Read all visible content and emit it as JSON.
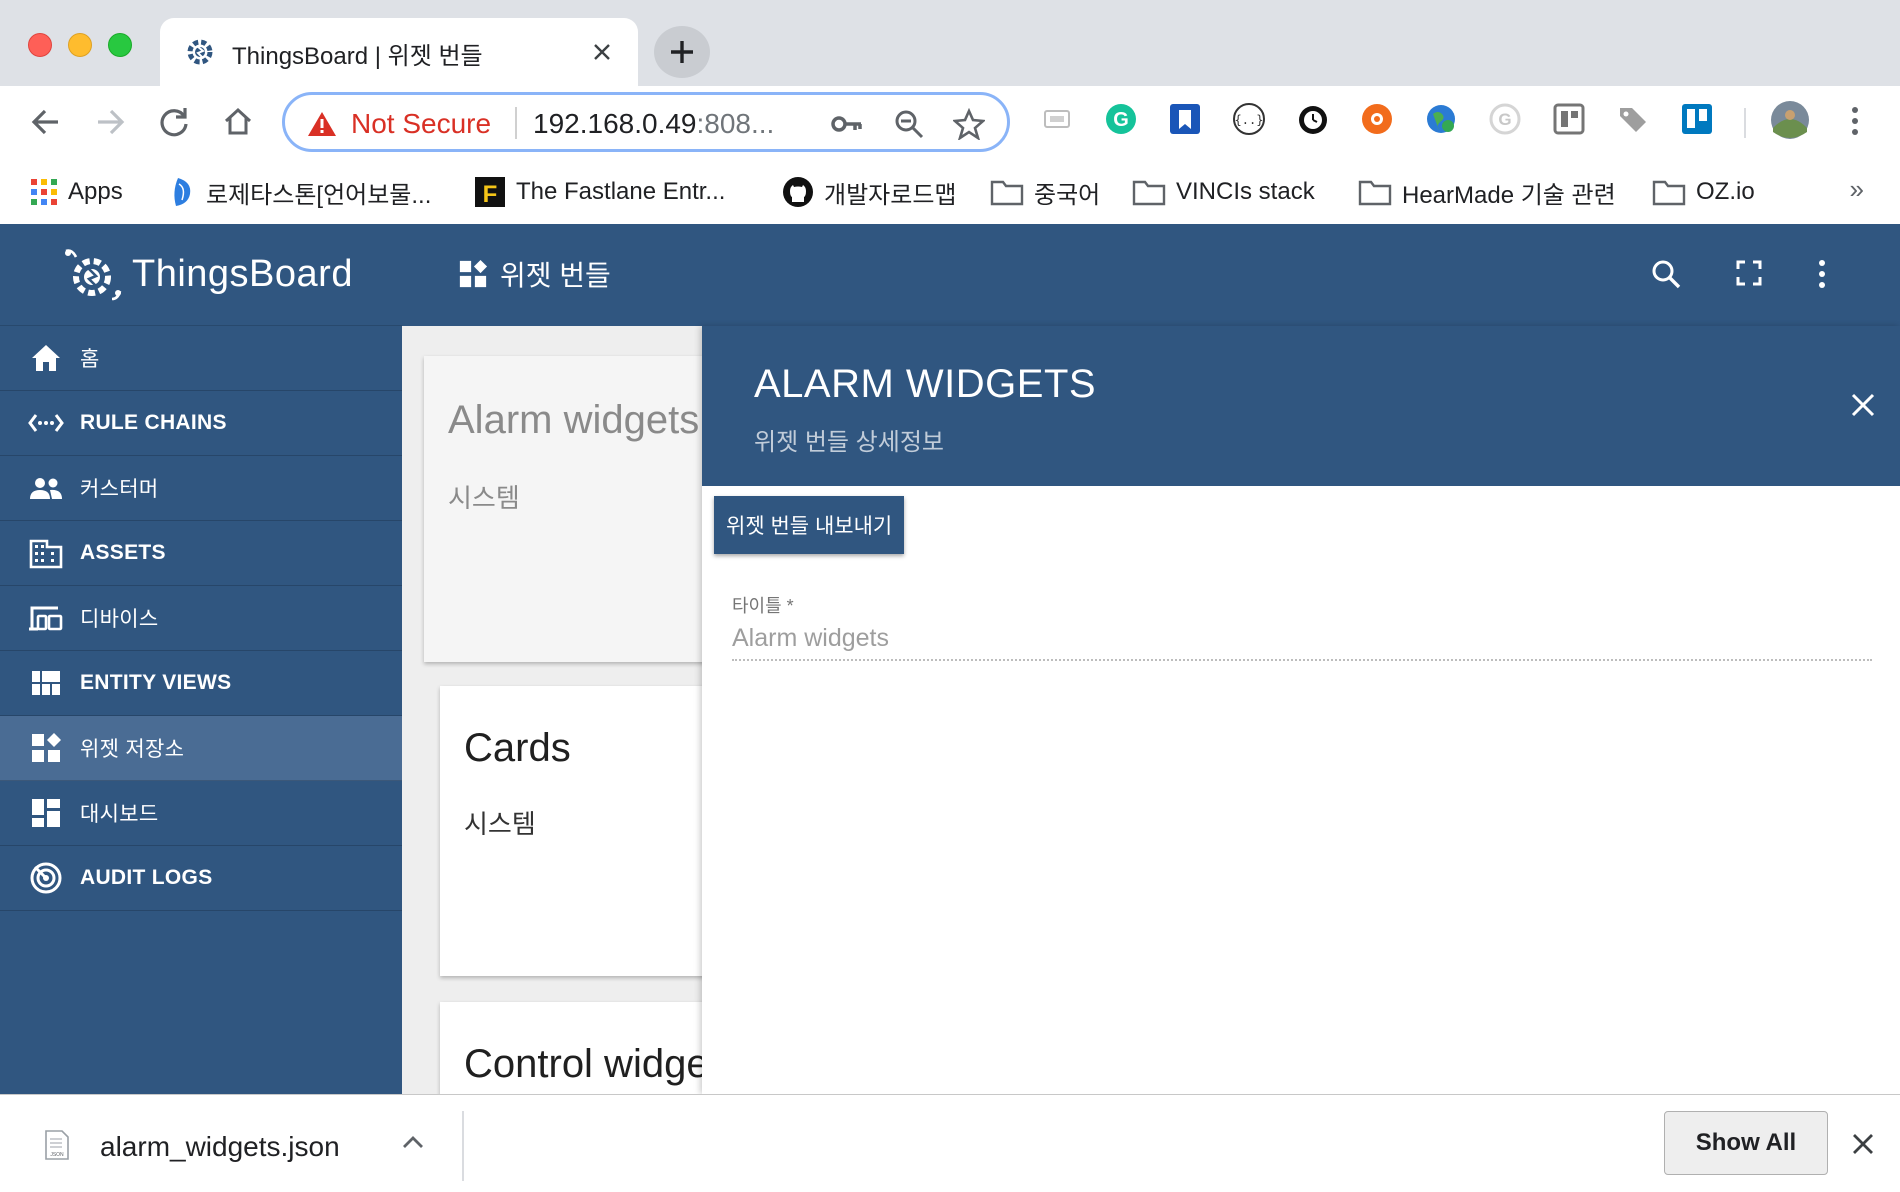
{
  "browser": {
    "tab": {
      "title": "ThingsBoard | 위젯 번들"
    },
    "address": {
      "security_label": "Not Secure",
      "url_main": "192.168.0.49",
      "url_dim": ":808..."
    },
    "bookmarks": [
      {
        "label": "Apps",
        "icon": "apps-grid-icon"
      },
      {
        "label": "로제타스톤[언어보물...",
        "icon": "rosetta-icon"
      },
      {
        "label": "The Fastlane Entr...",
        "icon": "fastlane-icon"
      },
      {
        "label": "개발자로드맵",
        "icon": "github-icon"
      },
      {
        "label": "중국어",
        "icon": "folder-icon"
      },
      {
        "label": "VINCIs stack",
        "icon": "folder-icon"
      },
      {
        "label": "HearMade 기술 관련",
        "icon": "folder-icon"
      },
      {
        "label": "OZ.io",
        "icon": "folder-icon"
      }
    ],
    "bookmarks_more": "»"
  },
  "app": {
    "logo_text": "ThingsBoard",
    "topbar_title": "위젯 번들",
    "sidebar": [
      {
        "label": "홈",
        "icon": "home-icon",
        "active": false
      },
      {
        "label": "RULE CHAINS",
        "icon": "rule-chains-icon",
        "active": false
      },
      {
        "label": "커스터머",
        "icon": "customers-icon",
        "active": false
      },
      {
        "label": "ASSETS",
        "icon": "assets-icon",
        "active": false
      },
      {
        "label": "디바이스",
        "icon": "devices-icon",
        "active": false
      },
      {
        "label": "ENTITY VIEWS",
        "icon": "entity-views-icon",
        "active": false
      },
      {
        "label": "위젯 저장소",
        "icon": "widgets-icon",
        "active": true
      },
      {
        "label": "대시보드",
        "icon": "dashboards-icon",
        "active": false
      },
      {
        "label": "AUDIT LOGS",
        "icon": "audit-logs-icon",
        "active": false
      }
    ],
    "cards": [
      {
        "title": "Alarm widgets",
        "subtitle": "시스템"
      },
      {
        "title": "Cards",
        "subtitle": "시스템"
      },
      {
        "title": "Control widge",
        "subtitle": ""
      }
    ],
    "detail": {
      "title": "ALARM WIDGETS",
      "subtitle": "위젯 번들 상세정보",
      "export_button": "위젯 번들 내보내기",
      "field_label": "타이틀 *",
      "field_value": "Alarm widgets"
    }
  },
  "downloads": {
    "file_name": "alarm_widgets.json",
    "show_all": "Show All"
  },
  "colors": {
    "primary": "#305680",
    "active_item": "#4a6c94",
    "warning": "#d93025"
  }
}
